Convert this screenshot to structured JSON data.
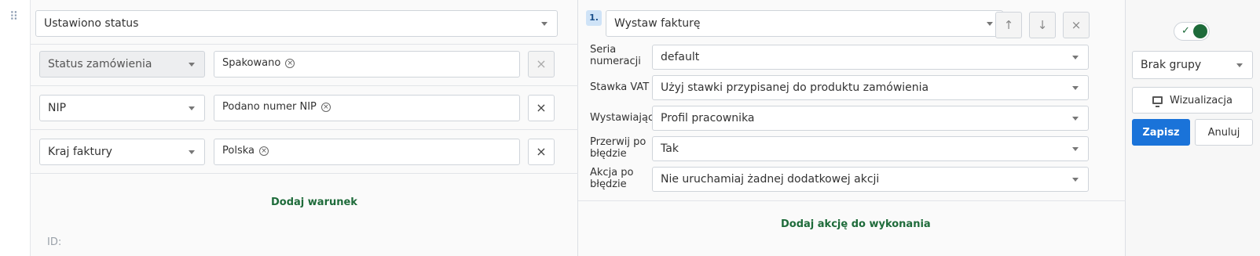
{
  "trigger": {
    "value": "Ustawiono status"
  },
  "conditions": [
    {
      "field": "Status zamówienia",
      "value": "Spakowano",
      "field_disabled": true
    },
    {
      "field": "NIP",
      "value": "Podano numer NIP",
      "field_disabled": false
    },
    {
      "field": "Kraj faktury",
      "value": "Polska",
      "field_disabled": false
    }
  ],
  "remove_label": "×",
  "chip_remove": "×",
  "add_condition_label": "Dodaj warunek",
  "id_label": "ID:",
  "action": {
    "number": "1.",
    "type": "Wystaw fakturę",
    "up_label": "↑",
    "down_label": "↓",
    "remove_label": "×",
    "params": [
      {
        "label": "Seria numeracji",
        "value": "default"
      },
      {
        "label": "Stawka VAT",
        "value": "Użyj stawki przypisanej do produktu zamówienia"
      },
      {
        "label": "Wystawiający",
        "value": "Profil pracownika"
      },
      {
        "label": "Przerwij po błędzie",
        "value": "Tak"
      },
      {
        "label": "Akcja po błędzie",
        "value": "Nie uruchamiaj żadnej dodatkowej akcji"
      }
    ]
  },
  "add_action_label": "Dodaj akcję do wykonania",
  "sidebar": {
    "toggle_on": true,
    "toggle_check": "✓",
    "group": "Brak grupy",
    "visualize_label": "Wizualizacja",
    "save_label": "Zapisz",
    "cancel_label": "Anuluj"
  },
  "colors": {
    "primary": "#1a73d9",
    "accent_green": "#1e6b3a"
  }
}
